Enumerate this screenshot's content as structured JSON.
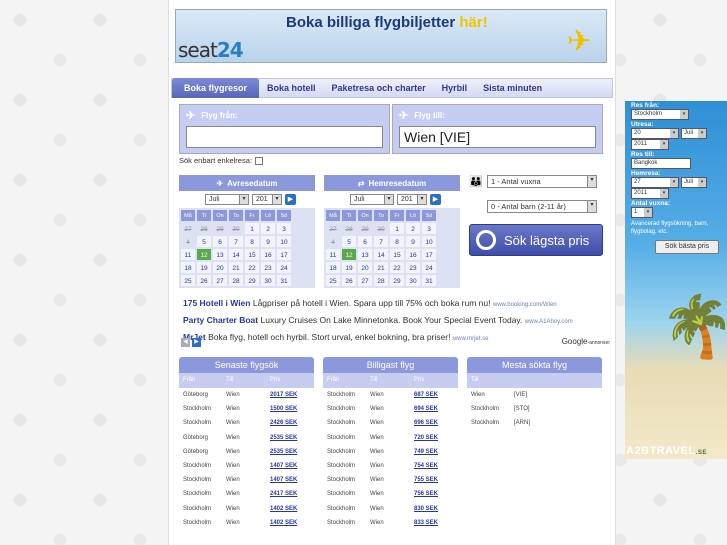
{
  "banner": {
    "headline": "Boka billiga flygbiljetter",
    "headline_em": "här!",
    "logo": "seat",
    "logo_num": "24"
  },
  "tabs": [
    "Boka flygresor",
    "Boka hotell",
    "Paketresa och charter",
    "Hyrbil",
    "Sista minuten"
  ],
  "search": {
    "from_label": "Flyg från:",
    "to_label": "Flyg till:",
    "from_value": "",
    "to_value": "Wien [VIE]"
  },
  "oneway_label": "Sök enbart enkelresa:",
  "calendars": [
    {
      "title": "Avresedatum",
      "day": "Juli",
      "year": "201"
    },
    {
      "title": "Hemresedatum",
      "day": "Juli",
      "year": "201"
    }
  ],
  "weekdays": [
    "Må",
    "Ti",
    "On",
    "To",
    "Fr",
    "Lö",
    "Sö"
  ],
  "cal_days": [
    [
      "27",
      "28",
      "29",
      "30",
      "1",
      "2",
      "3"
    ],
    [
      "4",
      "5",
      "6",
      "7",
      "8",
      "9",
      "10"
    ],
    [
      "11",
      "12",
      "13",
      "14",
      "15",
      "16",
      "17"
    ],
    [
      "18",
      "19",
      "20",
      "21",
      "22",
      "23",
      "24"
    ],
    [
      "25",
      "26",
      "27",
      "28",
      "29",
      "30",
      "31"
    ]
  ],
  "pax": {
    "adults": "1 - Antal vuxna",
    "children": "0 - Antal barn (2-11 år)"
  },
  "go_button": "Sök lägsta pris",
  "ads": [
    {
      "title": "175 Hotell i Wien",
      "text": "Lågpriser på hotell i Wien. Spara upp till 75% och boka rum nu!",
      "url": "www.booking.com/Wien"
    },
    {
      "title": "Party Charter Boat",
      "text": "Luxury Cruises On Lake Minnetonka. Book Your Special Event Today.",
      "url": "www.A1Ahoy.com"
    },
    {
      "title": "MrJet",
      "text": "Boka flyg, hotell och hyrbil. Stort urval, enkel bokning, bra priser!",
      "url": "www.mrjet.se"
    }
  ],
  "google": {
    "name": "Google",
    "suffix": "-annonser"
  },
  "tables": [
    {
      "title": "Senaste flygsök",
      "headers": [
        "Från",
        "Till",
        "Pris"
      ],
      "rows": [
        [
          "Göteborg",
          "Wien",
          "2017 SEK"
        ],
        [
          "Stockholm",
          "Wien",
          "1500 SEK"
        ],
        [
          "Stockholm",
          "Wien",
          "2426 SEK"
        ],
        [
          "Göteborg",
          "Wien",
          "2535 SEK"
        ],
        [
          "Göteborg",
          "Wien",
          "2535 SEK"
        ],
        [
          "Stockholm",
          "Wien",
          "1407 SEK"
        ],
        [
          "Stockholm",
          "Wien",
          "1407 SEK"
        ],
        [
          "Stockholm",
          "Wien",
          "2417 SEK"
        ],
        [
          "Stockholm",
          "Wien",
          "1402 SEK"
        ],
        [
          "Stockholm",
          "Wien",
          "1402 SEK"
        ]
      ]
    },
    {
      "title": "Billigast flyg",
      "headers": [
        "Från",
        "Till",
        "Pris"
      ],
      "rows": [
        [
          "Stockholm",
          "Wien",
          "687 SEK"
        ],
        [
          "Stockholm",
          "Wien",
          "694 SEK"
        ],
        [
          "Stockholm",
          "Wien",
          "696 SEK"
        ],
        [
          "Stockholm",
          "Wien",
          "720 SEK"
        ],
        [
          "Stockholm",
          "Wien",
          "749 SEK"
        ],
        [
          "Stockholm",
          "Wien",
          "754 SEK"
        ],
        [
          "Stockholm",
          "Wien",
          "755 SEK"
        ],
        [
          "Stockholm",
          "Wien",
          "756 SEK"
        ],
        [
          "Stockholm",
          "Wien",
          "830 SEK"
        ],
        [
          "Stockholm",
          "Wien",
          "833 SEK"
        ]
      ]
    },
    {
      "title": "Mesta sökta flyg",
      "headers": [
        "Till",
        "",
        ""
      ],
      "rows": [
        [
          "Wien",
          "[VIE]",
          ""
        ],
        [
          "Stockholm",
          "[STO]",
          ""
        ],
        [
          "Stockholm",
          "[ARN]",
          ""
        ]
      ]
    }
  ],
  "side": {
    "from_label": "Res från:",
    "from": "Stockholm",
    "out_label": "Utresa:",
    "out_day": "20",
    "out_month": "Juli",
    "out_year": "2011",
    "to_label": "Res till:",
    "to": "Bangkok",
    "home_label": "Hemresa:",
    "home_day": "27",
    "home_month": "Juli",
    "home_year": "2011",
    "adults_label": "Antal vuxna:",
    "adults": "1",
    "desc": "Avancerad flygsökning, barn, flygbolag, etc.",
    "button": "Sök bästa pris",
    "brand": "A2BTRAVEL",
    "brand_suffix": ".SE"
  },
  "colors": {
    "accent": "#8c98dc",
    "link": "#2638a0",
    "today": "#59a948"
  }
}
